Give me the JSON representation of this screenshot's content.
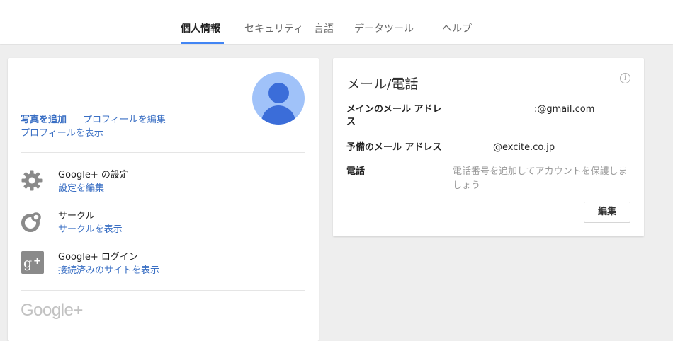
{
  "nav": {
    "tabs": [
      {
        "label": "個人情報",
        "active": true
      },
      {
        "label": "セキュリティ",
        "active": false
      },
      {
        "label": "言語",
        "active": false
      },
      {
        "label": "データツール",
        "active": false
      },
      {
        "label": "ヘルプ",
        "active": false
      }
    ],
    "accent_color": "#4285f4"
  },
  "profile": {
    "add_photo_label": "写真を追加",
    "edit_profile_label": "プロフィールを編集",
    "view_profile_label": "プロフィールを表示",
    "rows": [
      {
        "icon": "gear-icon",
        "title": "Google+ の設定",
        "link": "設定を編集"
      },
      {
        "icon": "circles-icon",
        "title": "サークル",
        "link": "サークルを表示"
      },
      {
        "icon": "google-plus-icon",
        "title": "Google+ ログイン",
        "link": "接続済みのサイトを表示"
      }
    ],
    "logo_text": "Google+"
  },
  "contact": {
    "title": "メール/電話",
    "main_email_label": "メインのメール アドレス",
    "main_email_value": ":@gmail.com",
    "backup_email_label": "予備のメール アドレス",
    "backup_email_value": "@excite.co.jp",
    "phone_label": "電話",
    "phone_placeholder": "電話番号を追加してアカウントを保護しましょう",
    "edit_label": "編集"
  }
}
